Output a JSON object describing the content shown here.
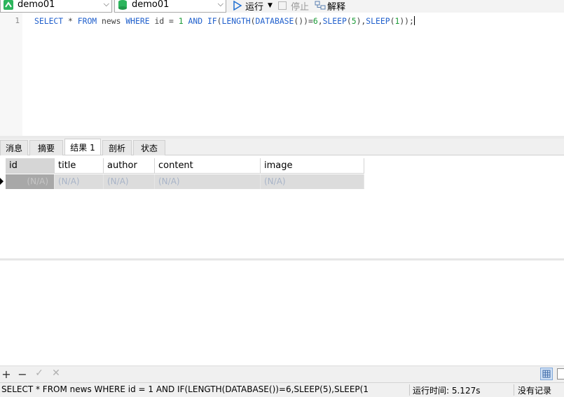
{
  "toolbar": {
    "connection": "demo01",
    "database": "demo01",
    "run_label": "运行",
    "stop_label": "停止",
    "explain_label": "解释",
    "colors": {
      "connection_icon": "#2db55d",
      "database_icon": "#2db55d",
      "run_icon": "#1f6fd1"
    }
  },
  "editor": {
    "line_number": "1",
    "tokens": [
      {
        "t": "SELECT",
        "c": "kw"
      },
      {
        "t": " * ",
        "c": ""
      },
      {
        "t": "FROM",
        "c": "kw"
      },
      {
        "t": " news ",
        "c": ""
      },
      {
        "t": "WHERE",
        "c": "kw"
      },
      {
        "t": " id = ",
        "c": ""
      },
      {
        "t": "1",
        "c": "num"
      },
      {
        "t": " ",
        "c": ""
      },
      {
        "t": "AND",
        "c": "kw"
      },
      {
        "t": " ",
        "c": ""
      },
      {
        "t": "IF",
        "c": "kw"
      },
      {
        "t": "(",
        "c": ""
      },
      {
        "t": "LENGTH",
        "c": "kw"
      },
      {
        "t": "(",
        "c": ""
      },
      {
        "t": "DATABASE",
        "c": "kw"
      },
      {
        "t": "())=",
        "c": ""
      },
      {
        "t": "6",
        "c": "num"
      },
      {
        "t": ",",
        "c": ""
      },
      {
        "t": "SLEEP",
        "c": "kw"
      },
      {
        "t": "(",
        "c": ""
      },
      {
        "t": "5",
        "c": "num"
      },
      {
        "t": "),",
        "c": ""
      },
      {
        "t": "SLEEP",
        "c": "kw"
      },
      {
        "t": "(",
        "c": ""
      },
      {
        "t": "1",
        "c": "num"
      },
      {
        "t": "));",
        "c": ""
      }
    ]
  },
  "tabs": [
    {
      "label": "消息"
    },
    {
      "label": "摘要"
    },
    {
      "label": "结果 1",
      "active": true
    },
    {
      "label": "剖析"
    },
    {
      "label": "状态"
    }
  ],
  "grid": {
    "columns": [
      "id",
      "title",
      "author",
      "content",
      "image"
    ],
    "rows": [
      [
        "(N/A)",
        "(N/A)",
        "(N/A)",
        "(N/A)",
        "(N/A)"
      ]
    ]
  },
  "gridbar": {
    "add": "+",
    "remove": "−",
    "apply": "✓",
    "discard": "✕"
  },
  "status": {
    "sql": "SELECT * FROM news WHERE id = 1 AND IF(LENGTH(DATABASE())=6,SLEEP(5),SLEEP(1",
    "time": "运行时间: 5.127s",
    "records": "没有记录"
  }
}
